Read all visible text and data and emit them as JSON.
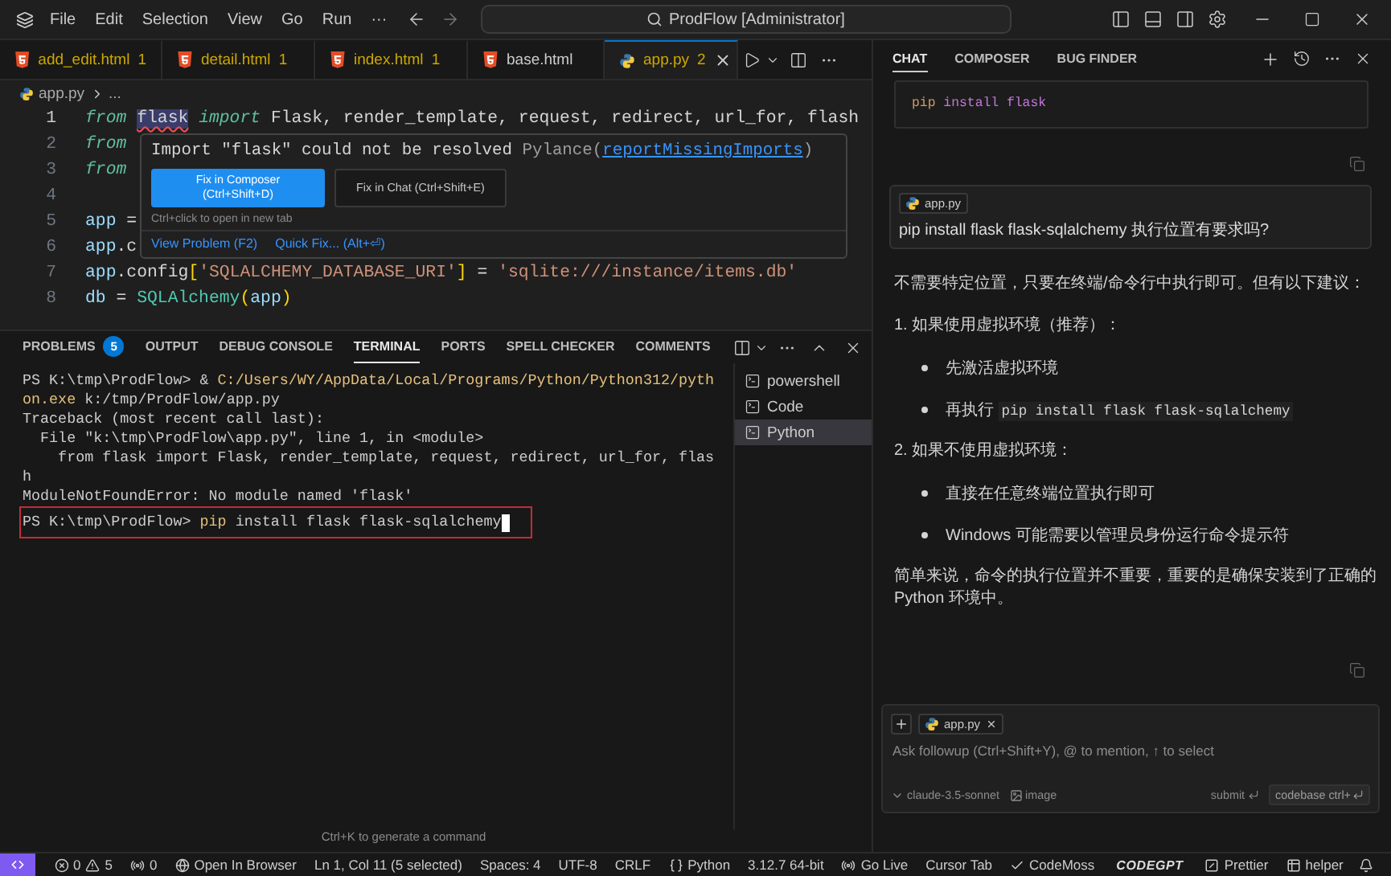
{
  "title_bar": {
    "menus": [
      "File",
      "Edit",
      "Selection",
      "View",
      "Go",
      "Run",
      "···"
    ],
    "search": "ProdFlow [Administrator]"
  },
  "editor": {
    "tabs": [
      {
        "name": "add_edit.html",
        "kind": "html",
        "count": "1",
        "selected": false
      },
      {
        "name": "detail.html",
        "kind": "html",
        "count": "1",
        "selected": false
      },
      {
        "name": "index.html",
        "kind": "html",
        "count": "1",
        "selected": false
      },
      {
        "name": "base.html",
        "kind": "html",
        "selected": false
      },
      {
        "name": "app.py",
        "kind": "python",
        "count": "2",
        "selected": true
      }
    ],
    "breadcrumb": {
      "file": "app.py",
      "rest": "..."
    },
    "lines": [
      {
        "number": "1",
        "tokens": [
          {
            "text": "from ",
            "kind": "keyword",
            "error": false
          },
          {
            "text": "flask",
            "kind": "module",
            "error": true
          },
          {
            "text": " import",
            "kind": "keyword",
            "error": false
          },
          {
            "text": " Flask, render_template, request, redirect, url_for, flash",
            "kind": "plain",
            "error": false
          }
        ]
      },
      {
        "number": "2",
        "tokens": [
          {
            "text": "from",
            "kind": "keyword"
          }
        ]
      },
      {
        "number": "3",
        "tokens": [
          {
            "text": "from",
            "kind": "keyword"
          }
        ]
      },
      {
        "number": "4"
      },
      {
        "number": "5",
        "tokens": [
          {
            "text": "app",
            "kind": "variable"
          },
          {
            "text": " =",
            "kind": "plain"
          }
        ]
      },
      {
        "number": "6",
        "tokens": [
          {
            "text": "app",
            "kind": "variable"
          },
          {
            "text": ".c",
            "kind": "plain"
          }
        ]
      },
      {
        "number": "7",
        "tokens": [
          {
            "text": "app",
            "kind": "variable"
          },
          {
            "text": ".config",
            "kind": "plain"
          },
          {
            "text": "[",
            "kind": "bracket"
          },
          {
            "text": "'SQLALCHEMY_DATABASE_URI'",
            "kind": "string"
          },
          {
            "text": "]",
            "kind": "bracket"
          },
          {
            "text": " = ",
            "kind": "plain"
          },
          {
            "text": "'sqlite:///instance/items.db'",
            "kind": "string"
          }
        ]
      },
      {
        "number": "8",
        "tokens": [
          {
            "text": "db",
            "kind": "variable"
          },
          {
            "text": " = ",
            "kind": "plain"
          },
          {
            "text": "SQLAlchemy",
            "kind": "class"
          },
          {
            "text": "(",
            "kind": "bracket"
          },
          {
            "text": "app",
            "kind": "variable"
          },
          {
            "text": ")",
            "kind": "bracket"
          }
        ]
      }
    ],
    "hover": {
      "message": "Import \"flask\" could not be resolved",
      "source": "Pylance(",
      "rule": "reportMissingImports",
      "source_end": ")",
      "buttons": [
        {
          "label": "Fix in Composer (Ctrl+Shift+D)",
          "primary": true
        },
        {
          "label": "Fix in Chat (Ctrl+Shift+E)",
          "primary": false
        }
      ],
      "hint": "Ctrl+click to open in new tab",
      "actions": [
        "View Problem (F2)",
        "Quick Fix... (Alt+⏎)"
      ]
    }
  },
  "panel": {
    "tabs": [
      {
        "label": "PROBLEMS",
        "badge": "5",
        "selected": false
      },
      {
        "label": "OUTPUT",
        "selected": false
      },
      {
        "label": "DEBUG CONSOLE",
        "selected": false
      },
      {
        "label": "TERMINAL",
        "selected": true
      },
      {
        "label": "PORTS",
        "selected": false
      },
      {
        "label": "SPELL CHECKER",
        "selected": false
      },
      {
        "label": "COMMENTS",
        "selected": false
      }
    ],
    "terminal": [
      {
        "outlined": false,
        "segments": [
          {
            "text": "PS K:\\tmp\\ProdFlow> & ",
            "kind": "plain"
          },
          {
            "text": "C:/Users/WY/AppData/Local/Programs/Python/Python312/pyth",
            "kind": "path"
          }
        ]
      },
      {
        "outlined": false,
        "segments": [
          {
            "text": "on.exe",
            "kind": "path"
          },
          {
            "text": " k:/tmp/ProdFlow/app.py",
            "kind": "plain"
          }
        ]
      },
      {
        "outlined": false,
        "segments": [
          {
            "text": "Traceback (most recent call last):",
            "kind": "plain"
          }
        ]
      },
      {
        "outlined": false,
        "segments": [
          {
            "text": "  File \"k:\\tmp\\ProdFlow\\app.py\", line 1, in <module>",
            "kind": "plain"
          }
        ]
      },
      {
        "outlined": false,
        "segments": [
          {
            "text": "    from flask import Flask, render_template, request, redirect, url_for, flas",
            "kind": "plain"
          }
        ]
      },
      {
        "outlined": false,
        "segments": [
          {
            "text": "h",
            "kind": "plain"
          }
        ]
      },
      {
        "outlined": false,
        "segments": [
          {
            "text": "ModuleNotFoundError: No module named 'flask'",
            "kind": "plain"
          }
        ]
      },
      {
        "outlined": true,
        "cursor": true,
        "segments": [
          {
            "text": "PS K:\\tmp\\ProdFlow> ",
            "kind": "plain"
          },
          {
            "text": "pip",
            "kind": "path"
          },
          {
            "text": " install flask flask-sqlalchemy",
            "kind": "plain"
          }
        ]
      }
    ],
    "terminals": [
      {
        "name": "powershell",
        "selected": false
      },
      {
        "name": "Code",
        "selected": false
      },
      {
        "name": "Python",
        "selected": true
      }
    ],
    "hint": "Ctrl+K to generate a command"
  },
  "chat": {
    "tabs": [
      {
        "label": "CHAT",
        "selected": true
      },
      {
        "label": "COMPOSER",
        "selected": false
      },
      {
        "label": "BUG FINDER",
        "selected": false
      }
    ],
    "code_block": [
      {
        "text": "pip",
        "kind": "command"
      },
      {
        "text": " install flask",
        "kind": "argument"
      }
    ],
    "question": {
      "file": "app.py",
      "text": "pip install flask flask-sqlalchemy 执行位置有要求吗?"
    },
    "answer": [
      {
        "kind": "paragraph",
        "text": "不需要特定位置，只要在终端/命令行中执行即可。但有以下建议："
      },
      {
        "kind": "heading",
        "text": "1. 如果使用虚拟环境（推荐）："
      },
      {
        "kind": "bullet",
        "text": "先激活虚拟环境"
      },
      {
        "kind": "bullet",
        "text": "再执行 ",
        "code": "pip install flask flask-sqlalchemy"
      },
      {
        "kind": "heading",
        "text": "2. 如果不使用虚拟环境："
      },
      {
        "kind": "bullet",
        "text": "直接在任意终端位置执行即可"
      },
      {
        "kind": "bullet",
        "text": "Windows 可能需要以管理员身份运行命令提示符"
      },
      {
        "kind": "paragraph",
        "text": "简单来说，命令的执行位置并不重要，重要的是确保安装到了正确的Python 环境中。"
      }
    ],
    "input": {
      "file": "app.py",
      "placeholder": "Ask followup (Ctrl+Shift+Y), @ to mention, ↑ to select",
      "model": "claude-3.5-sonnet",
      "image": "image",
      "submit": "submit",
      "codebase": "codebase ctrl+"
    }
  },
  "status_bar": [
    {
      "kind": "problems",
      "errors": "0",
      "warnings": "5"
    },
    {
      "kind": "ports",
      "text": "0"
    },
    {
      "kind": "browser",
      "text": "Open In Browser"
    },
    {
      "kind": "text",
      "text": "Ln 1, Col 11 (5 selected)"
    },
    {
      "kind": "text",
      "text": "Spaces: 4"
    },
    {
      "kind": "text",
      "text": "UTF-8"
    },
    {
      "kind": "text",
      "text": "CRLF"
    },
    {
      "kind": "language",
      "text": "Python"
    },
    {
      "kind": "text",
      "text": "3.12.7 64-bit"
    },
    {
      "kind": "live",
      "text": "Go Live"
    },
    {
      "kind": "text",
      "text": "Cursor Tab"
    },
    {
      "kind": "check",
      "text": "CodeMoss"
    },
    {
      "kind": "logo",
      "text": "CODEGPT"
    },
    {
      "kind": "prettier",
      "text": "Prettier"
    },
    {
      "kind": "helper",
      "text": "helper"
    },
    {
      "kind": "bell"
    }
  ]
}
